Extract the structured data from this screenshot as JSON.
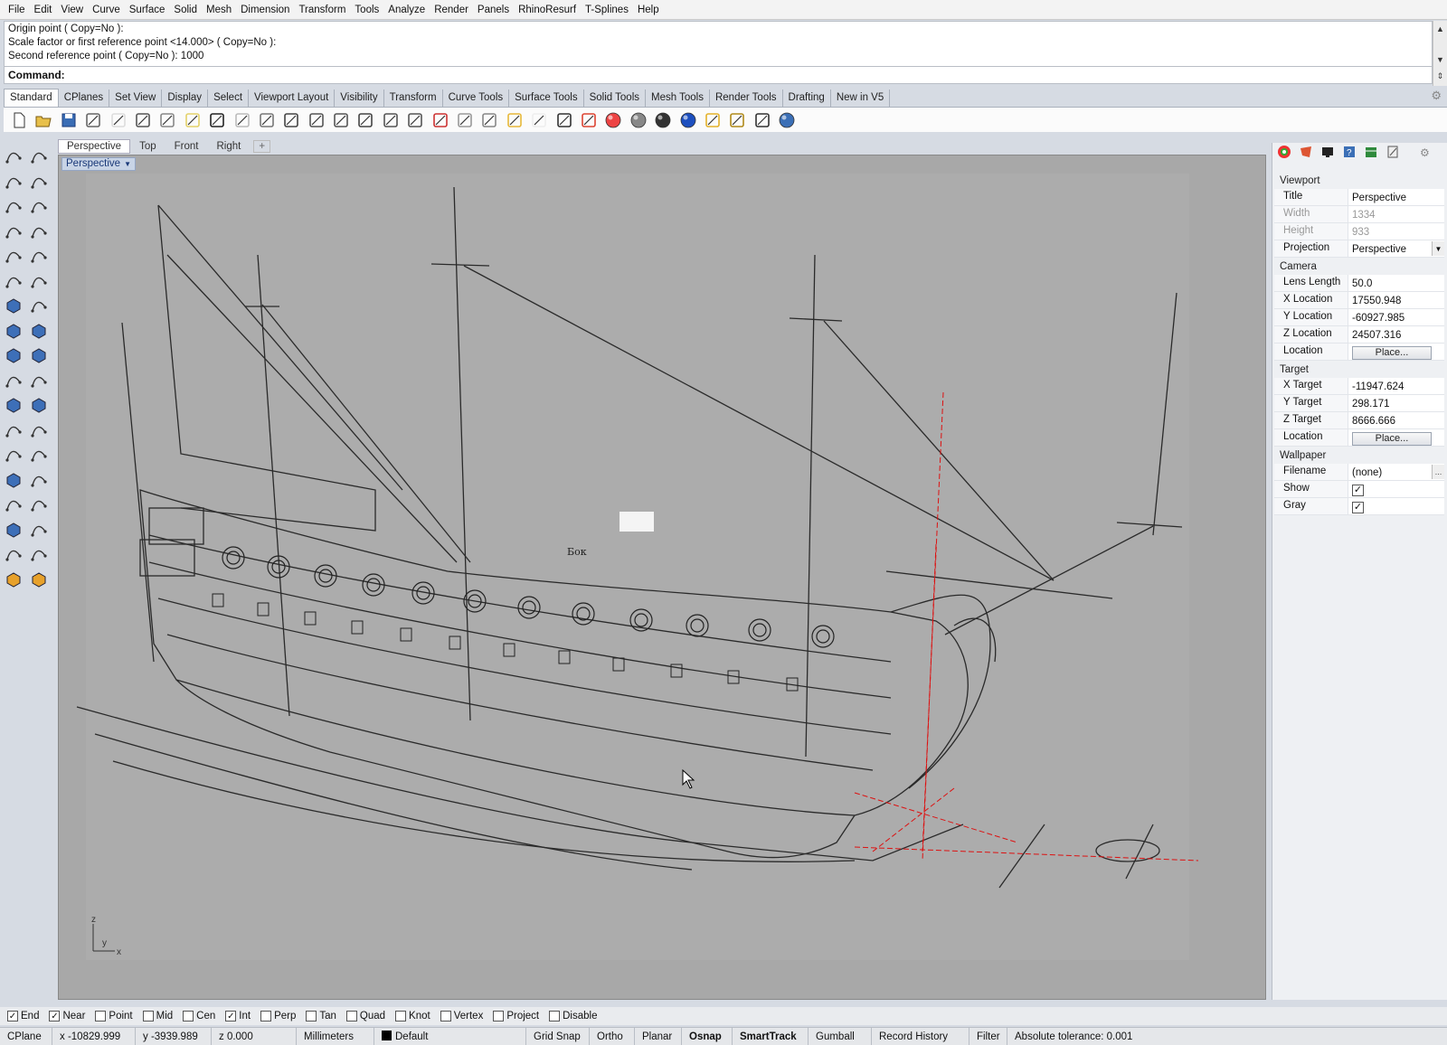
{
  "menu": [
    "File",
    "Edit",
    "View",
    "Curve",
    "Surface",
    "Solid",
    "Mesh",
    "Dimension",
    "Transform",
    "Tools",
    "Analyze",
    "Render",
    "Panels",
    "RhinoResurf",
    "T-Splines",
    "Help"
  ],
  "command_history": [
    "Origin point ( Copy=No ):",
    "Scale factor or first reference point <14.000> ( Copy=No ):",
    "Second reference point ( Copy=No ): 1000"
  ],
  "command_label": "Command:",
  "toolbar_tabs": [
    "Standard",
    "CPlanes",
    "Set View",
    "Display",
    "Select",
    "Viewport Layout",
    "Visibility",
    "Transform",
    "Curve Tools",
    "Surface Tools",
    "Solid Tools",
    "Mesh Tools",
    "Render Tools",
    "Drafting",
    "New in V5"
  ],
  "toolbar_icons": [
    "new-file-icon",
    "open-icon",
    "save-icon",
    "print-icon",
    "import-icon",
    "cut-icon",
    "copy-icon",
    "paste-icon",
    "undo-icon",
    "pan-icon",
    "rotate-view-icon",
    "zoom-in-icon",
    "zoom-window-icon",
    "zoom-extents-icon",
    "zoom-selected-icon",
    "rotate-icon",
    "four-viewports-icon",
    "car-icon",
    "shaded-icon",
    "circle-icon",
    "layer-icon",
    "light-icon",
    "lock-icon",
    "material-icon",
    "color-wheel-icon",
    "sphere-gray-icon",
    "sphere-dark-icon",
    "sphere-blue-icon",
    "filter-icon",
    "settings-icon",
    "dimension-icon",
    "help-icon"
  ],
  "viewport_tabs": [
    "Perspective",
    "Top",
    "Front",
    "Right"
  ],
  "viewport_title": "Perspective",
  "drawing_labels": {
    "bok": "Бок"
  },
  "axes": {
    "z": "z",
    "y": "y",
    "x": "x"
  },
  "panel": {
    "viewport_header": "Viewport",
    "viewport_rows": [
      {
        "k": "Title",
        "v": "Perspective"
      },
      {
        "k": "Width",
        "v": "1334"
      },
      {
        "k": "Height",
        "v": "933"
      },
      {
        "k": "Projection",
        "v": "Perspective"
      }
    ],
    "camera_header": "Camera",
    "camera_rows": [
      {
        "k": "Lens Length",
        "v": "50.0"
      },
      {
        "k": "X Location",
        "v": "17550.948"
      },
      {
        "k": "Y Location",
        "v": "-60927.985"
      },
      {
        "k": "Z Location",
        "v": "24507.316"
      },
      {
        "k": "Location",
        "v": "Place..."
      }
    ],
    "target_header": "Target",
    "target_rows": [
      {
        "k": "X Target",
        "v": "-11947.624"
      },
      {
        "k": "Y Target",
        "v": "298.171"
      },
      {
        "k": "Z Target",
        "v": "8666.666"
      },
      {
        "k": "Location",
        "v": "Place..."
      }
    ],
    "wallpaper_header": "Wallpaper",
    "wallpaper_rows": [
      {
        "k": "Filename",
        "v": "(none)"
      },
      {
        "k": "Show",
        "v": "checked"
      },
      {
        "k": "Gray",
        "v": "checked"
      }
    ]
  },
  "osnaps": [
    {
      "label": "End",
      "checked": true
    },
    {
      "label": "Near",
      "checked": true
    },
    {
      "label": "Point",
      "checked": false
    },
    {
      "label": "Mid",
      "checked": false
    },
    {
      "label": "Cen",
      "checked": false
    },
    {
      "label": "Int",
      "checked": true
    },
    {
      "label": "Perp",
      "checked": false
    },
    {
      "label": "Tan",
      "checked": false
    },
    {
      "label": "Quad",
      "checked": false
    },
    {
      "label": "Knot",
      "checked": false
    },
    {
      "label": "Vertex",
      "checked": false
    },
    {
      "label": "Project",
      "checked": false
    },
    {
      "label": "Disable",
      "checked": false
    }
  ],
  "status": {
    "cplane": "CPlane",
    "x": "x -10829.999",
    "y": "y -3939.989",
    "z": "z 0.000",
    "units": "Millimeters",
    "layer": "Default",
    "grid_snap": "Grid Snap",
    "ortho": "Ortho",
    "planar": "Planar",
    "osnap": "Osnap",
    "smarttrack": "SmartTrack",
    "gumball": "Gumball",
    "record_history": "Record History",
    "filter": "Filter",
    "tolerance": "Absolute tolerance: 0.001"
  }
}
